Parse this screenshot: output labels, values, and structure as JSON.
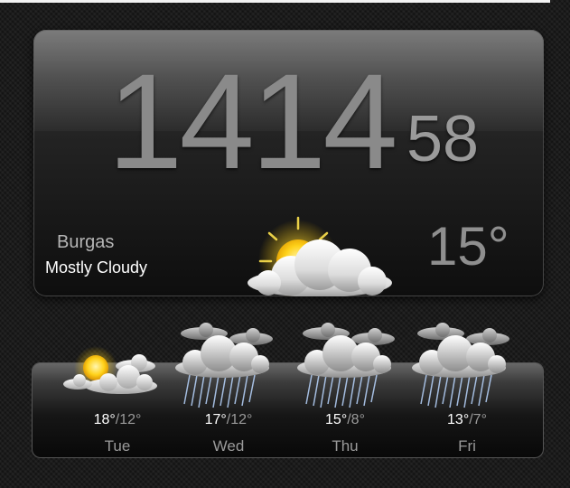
{
  "clock": {
    "hour": "1414",
    "minute": "58"
  },
  "current": {
    "city": "Burgas",
    "condition": "Mostly Cloudy",
    "temperature": "15°",
    "icon": "sun-behind-cloud-icon"
  },
  "forecast": [
    {
      "day": "Tue",
      "high": "18°",
      "low": "12°",
      "icon": "partly-sunny-icon"
    },
    {
      "day": "Wed",
      "high": "17°",
      "low": "12°",
      "icon": "rain-cloud-icon"
    },
    {
      "day": "Thu",
      "high": "15°",
      "low": "8°",
      "icon": "rain-cloud-icon"
    },
    {
      "day": "Fri",
      "high": "13°",
      "low": "7°",
      "icon": "rain-cloud-icon"
    }
  ],
  "colors": {
    "sun": "#ffd21a",
    "cloud": "#e6e6e6",
    "rain": "#b9d6ff"
  }
}
